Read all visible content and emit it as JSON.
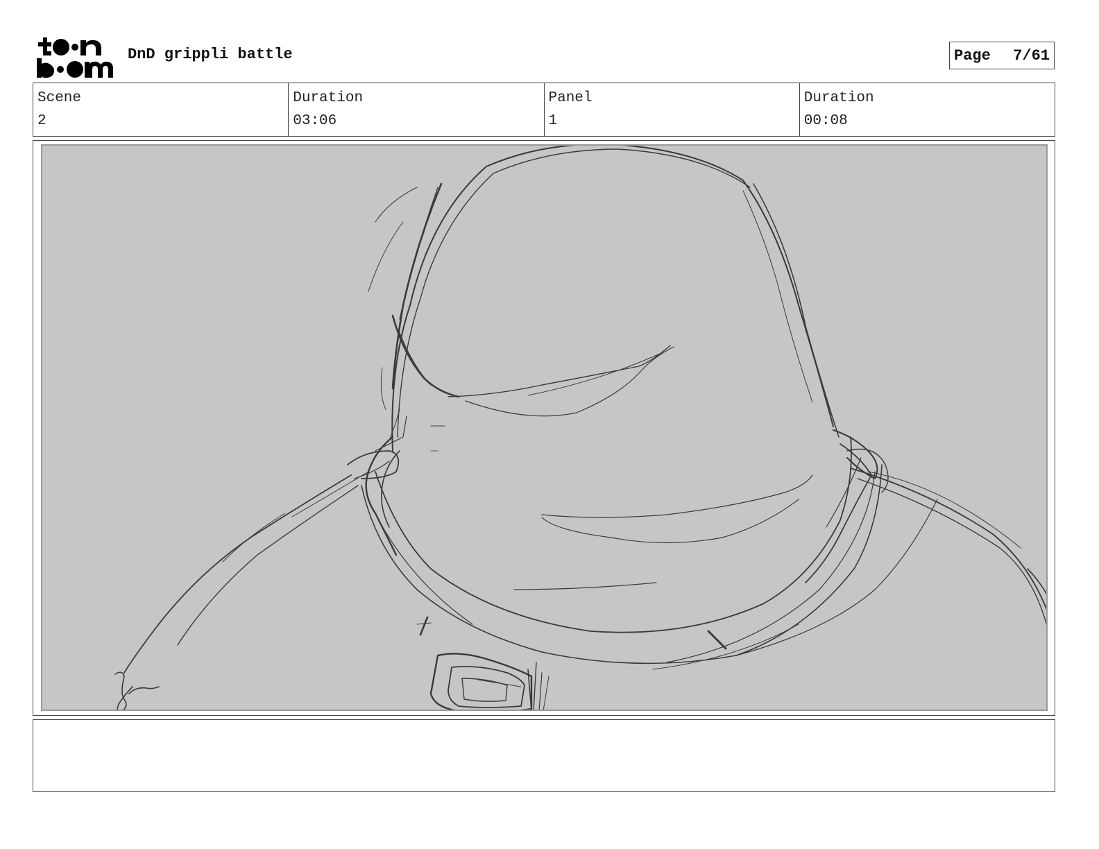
{
  "header": {
    "logo_text": "toon boom",
    "project_title": "DnD grippli battle",
    "page_label": "Page",
    "page_number": "7/61"
  },
  "info": {
    "scene_label": "Scene",
    "scene_value": "2",
    "scene_duration_label": "Duration",
    "scene_duration_value": "03:06",
    "panel_label": "Panel",
    "panel_value": "1",
    "panel_duration_label": "Duration",
    "panel_duration_value": "00:08"
  },
  "panel": {
    "background_color": "#c6c6c6",
    "sketch_color": "#3a3a3a",
    "signature": "jr"
  },
  "notes": {
    "text": ""
  }
}
